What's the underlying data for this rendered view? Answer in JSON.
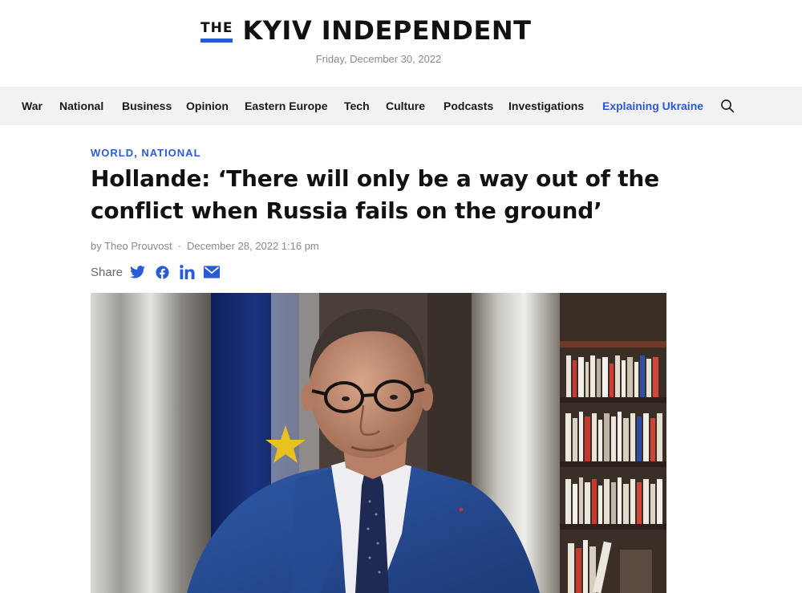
{
  "masthead": {
    "logo_the": "THE",
    "logo_main": "KYIV INDEPENDENT",
    "date": "Friday, December 30, 2022"
  },
  "nav": {
    "items": [
      {
        "label": "War"
      },
      {
        "label": "National"
      },
      {
        "label": "Business"
      },
      {
        "label": "Opinion"
      },
      {
        "label": "Eastern Europe"
      },
      {
        "label": "Tech"
      },
      {
        "label": "Culture"
      },
      {
        "label": "Podcasts"
      },
      {
        "label": "Investigations"
      },
      {
        "label": "Explaining Ukraine"
      }
    ],
    "search_icon": "search-icon",
    "accent_color": "#2a5bd7"
  },
  "article": {
    "category": "WORLD, NATIONAL",
    "headline": "Hollande: ‘There will only be a way out of the conflict when Russia fails on the ground’",
    "author": "by Theo Prouvost",
    "separator": "·",
    "published": "December 28, 2022 1:16 pm",
    "share_label": "Share",
    "share_icons": [
      "twitter-icon",
      "facebook-icon",
      "linkedin-icon",
      "email-icon"
    ]
  }
}
